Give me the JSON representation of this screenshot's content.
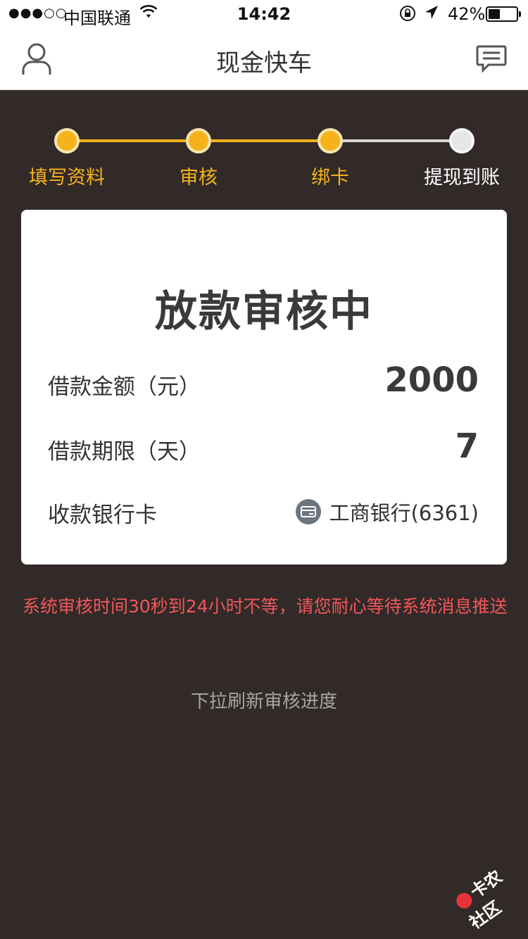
{
  "status_bar": {
    "signal": "●●●○○",
    "carrier": "中国联通",
    "time": "14:42",
    "battery_percent": "42%",
    "battery_level": 0.42
  },
  "nav": {
    "title": "现金快车",
    "left_icon": "user-icon",
    "right_icon": "message-icon"
  },
  "steps": [
    {
      "label": "填写资料",
      "state": "done"
    },
    {
      "label": "审核",
      "state": "done"
    },
    {
      "label": "绑卡",
      "state": "done"
    },
    {
      "label": "提现到账",
      "state": "pending"
    }
  ],
  "card": {
    "heading": "放款审核中",
    "amount_label": "借款金额（元）",
    "amount_value": "2000",
    "term_label": "借款期限（天）",
    "term_value": "7",
    "bank_label": "收款银行卡",
    "bank_value": "工商银行(6361)",
    "bank_icon": "bank-card-icon"
  },
  "notice": "系统审核时间30秒到24小时不等，请您耐心等待系统消息推送",
  "pull_hint": "下拉刷新审核进度",
  "watermark": "卡农社区",
  "colors": {
    "accent": "#f5b21a",
    "background": "#322a28",
    "notice": "#f0565a"
  }
}
